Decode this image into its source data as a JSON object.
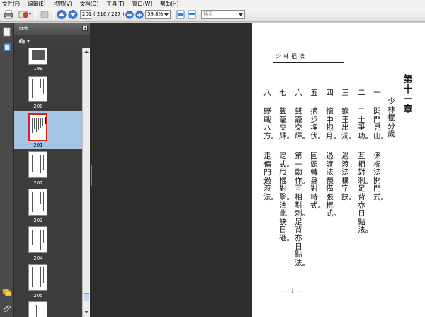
{
  "menubar": [
    "文件(F)",
    "编辑(E)",
    "视图(V)",
    "文档(D)",
    "工具(T)",
    "窗口(W)",
    "帮助(H)"
  ],
  "toolbar": {
    "page_number": "201",
    "page_count": "( 216 / 227 )",
    "zoom": "59.8%",
    "search_placeholder": "搜索"
  },
  "sidebar": {
    "title": "页面",
    "thumbnails": [
      {
        "label": "199",
        "selected": false
      },
      {
        "label": "200",
        "selected": false
      },
      {
        "label": "201",
        "selected": true
      },
      {
        "label": "202",
        "selected": false
      },
      {
        "label": "203",
        "selected": false
      },
      {
        "label": "204",
        "selected": false
      },
      {
        "label": "205",
        "selected": false
      }
    ]
  },
  "document": {
    "heading": "少林棍法",
    "chapter": "第十一章",
    "subtitle": "少林棍分歲",
    "columns": [
      {
        "num": "一",
        "lines": [
          "開門見山。",
          "係棍法開門式。"
        ]
      },
      {
        "num": "二",
        "lines": [
          "二士爭功。",
          "互相對刺。足背亦日點法。"
        ]
      },
      {
        "num": "三",
        "lines": [
          "猴王出洞。",
          "過渡法構字訣。"
        ]
      },
      {
        "num": "四",
        "lines": [
          "懷中抱月。",
          "過渡法預備張棍式。"
        ]
      },
      {
        "num": "五",
        "lines": [
          "摘步埋伏。",
          "回頭轉身對峙式。"
        ]
      },
      {
        "num": "六",
        "lines": [
          "雙籠交輝。",
          "第一動作。互相對刺。足背亦日點法。"
        ]
      },
      {
        "num": "七",
        "lines": [
          "雙籠交輝。",
          "定式。甩棍對擊。法此訣日砸。"
        ]
      },
      {
        "num": "八",
        "lines": [
          "野戰八方。",
          "走偏門過渡法。"
        ]
      }
    ],
    "page_footer": "— 1 —"
  }
}
